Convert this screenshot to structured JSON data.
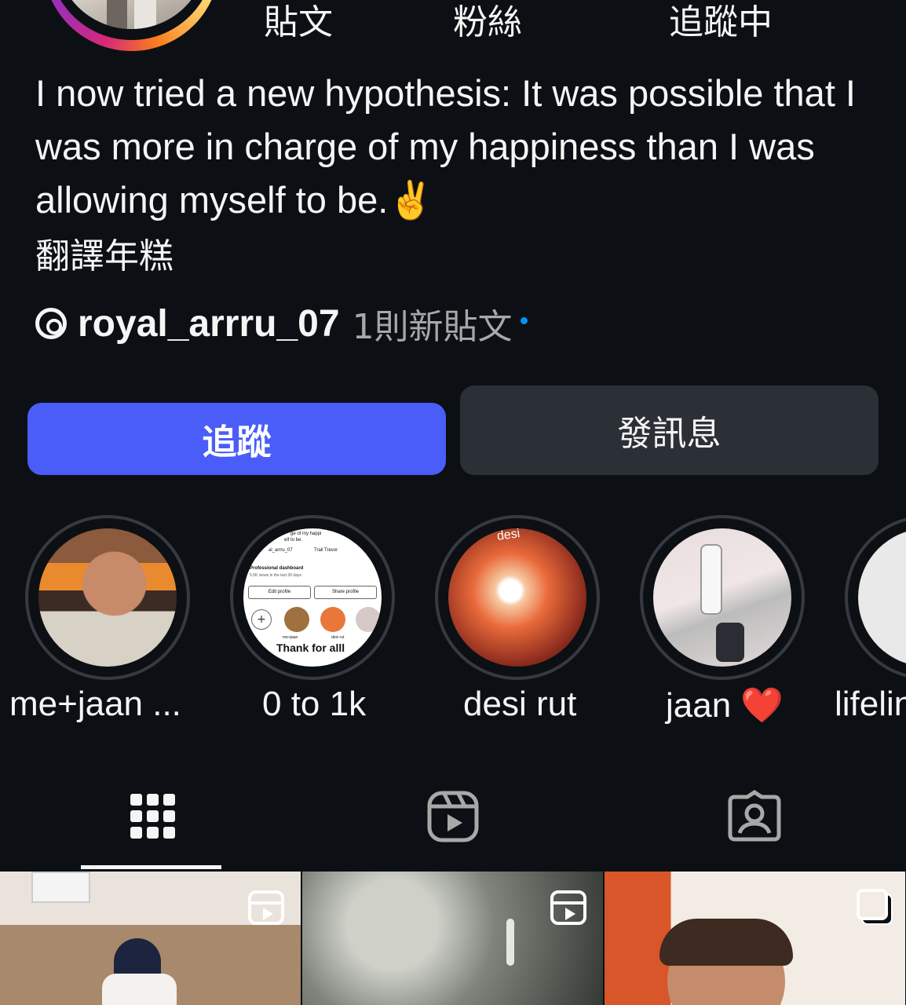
{
  "profile": {
    "stats": {
      "posts_label": "貼文",
      "followers_label": "粉絲",
      "following_label": "追蹤中"
    },
    "bio": {
      "line1": "I now tried a new hypothesis: It was possible that I was more in charge of my happiness than I was allowing myself to be.✌️",
      "line2": "翻譯年糕"
    },
    "threads": {
      "icon": "threads-icon",
      "username": "royal_arrru_07",
      "new_posts": "1則新貼文"
    },
    "buttons": {
      "follow": "追蹤",
      "message": "發訊息"
    }
  },
  "highlights": [
    {
      "label": "me+jaan ..."
    },
    {
      "label": "0 to 1k",
      "thumb_text": {
        "caption_snippet": "ge of my happi",
        "caption_snippet2": "elf to be.",
        "handle": "al_arrru_07",
        "music": "Trail Trevor",
        "dashboard": "Professional dashboard",
        "views": "5.5K views in the last 30 days",
        "edit": "Edit profile",
        "share": "Share profile",
        "hl1": "me+jaan",
        "hl2": "desi rut",
        "footer": "Thank for alll"
      }
    },
    {
      "label": "desi rut",
      "thumb_text": "desi"
    },
    {
      "label": "jaan ❤️"
    },
    {
      "label": "lifelin"
    }
  ],
  "tabs": [
    {
      "name": "grid",
      "icon": "grid-icon",
      "active": true
    },
    {
      "name": "reels",
      "icon": "reels-icon",
      "active": false
    },
    {
      "name": "tagged",
      "icon": "tagged-icon",
      "active": false
    }
  ],
  "posts": [
    {
      "type": "reel",
      "icon": "reel-icon"
    },
    {
      "type": "reel",
      "icon": "reel-icon"
    },
    {
      "type": "carousel",
      "icon": "carousel-icon"
    }
  ],
  "colors": {
    "background": "#0c1014",
    "follow_button": "#4a5df9",
    "message_button": "#2b3036",
    "secondary_text": "#a8a8a8",
    "new_dot": "#0095f6"
  }
}
